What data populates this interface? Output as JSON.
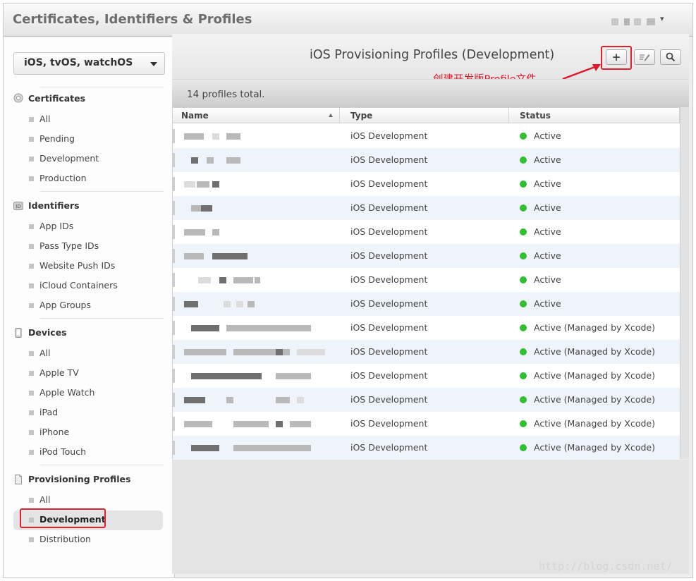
{
  "app": {
    "title": "Certificates, Identifiers & Profiles"
  },
  "sidebar": {
    "platform": "iOS, tvOS, watchOS",
    "sections": [
      {
        "title": "Certificates",
        "icon": "certificate-icon",
        "items": [
          "All",
          "Pending",
          "Development",
          "Production"
        ]
      },
      {
        "title": "Identifiers",
        "icon": "id-badge-icon",
        "items": [
          "App IDs",
          "Pass Type IDs",
          "Website Push IDs",
          "iCloud Containers",
          "App Groups"
        ]
      },
      {
        "title": "Devices",
        "icon": "phone-icon",
        "items": [
          "All",
          "Apple TV",
          "Apple Watch",
          "iPad",
          "iPhone",
          "iPod Touch"
        ]
      },
      {
        "title": "Provisioning Profiles",
        "icon": "document-icon",
        "items": [
          "All",
          "Development",
          "Distribution"
        ]
      }
    ],
    "active_item": "Development"
  },
  "main": {
    "title": "iOS Provisioning Profiles (Development)",
    "buttons": {
      "add": "+",
      "edit": "edit-icon",
      "search": "search-icon"
    },
    "annotation": "创建开发版Profile文件",
    "total": "14 profiles total."
  },
  "table": {
    "columns": [
      "Name",
      "Type",
      "Status"
    ],
    "rows": [
      {
        "type": "iOS Development",
        "status": "Active"
      },
      {
        "type": "iOS Development",
        "status": "Active"
      },
      {
        "type": "iOS Development",
        "status": "Active"
      },
      {
        "type": "iOS Development",
        "status": "Active"
      },
      {
        "type": "iOS Development",
        "status": "Active"
      },
      {
        "type": "iOS Development",
        "status": "Active"
      },
      {
        "type": "iOS Development",
        "status": "Active"
      },
      {
        "type": "iOS Development",
        "status": "Active"
      },
      {
        "type": "iOS Development",
        "status": "Active (Managed by Xcode)"
      },
      {
        "type": "iOS Development",
        "status": "Active (Managed by Xcode)"
      },
      {
        "type": "iOS Development",
        "status": "Active (Managed by Xcode)"
      },
      {
        "type": "iOS Development",
        "status": "Active (Managed by Xcode)"
      },
      {
        "type": "iOS Development",
        "status": "Active (Managed by Xcode)"
      },
      {
        "type": "iOS Development",
        "status": "Active (Managed by Xcode)"
      }
    ]
  },
  "colors": {
    "accent_red": "#e3172a",
    "status_green": "#2fbf2f"
  },
  "watermark": "http://blog.csdn.net/"
}
